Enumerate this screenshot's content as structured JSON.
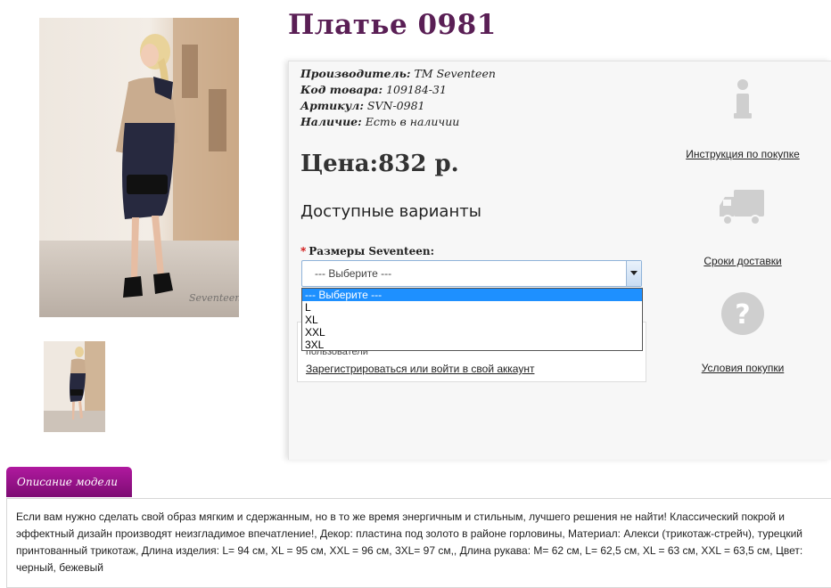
{
  "product": {
    "title": "Платье 0981",
    "meta": [
      {
        "label": "Производитель:",
        "value": "TM Seventeen"
      },
      {
        "label": "Код товара:",
        "value": "109184-31"
      },
      {
        "label": "Артикул:",
        "value": "SVN-0981"
      },
      {
        "label": "Наличие:",
        "value": "Есть в наличии"
      }
    ],
    "price": "Цена:832 р."
  },
  "options": {
    "title": "Доступные варианты",
    "size_label": "Размеры Seventeen:",
    "required_mark": "*",
    "selected": "--- Выберите ---",
    "list": [
      "--- Выберите ---",
      "L",
      "XL",
      "XXL",
      "3XL"
    ]
  },
  "review": {
    "partial_text": "пользователи",
    "login_link": "Зарегистрироваться или войти в свой аккаунт"
  },
  "sidebar": {
    "items": [
      {
        "label": "Инструкция по покупке",
        "icon": "info-icon"
      },
      {
        "label": "Сроки доставки",
        "icon": "truck-icon"
      },
      {
        "label": "Условия покупки",
        "icon": "question-icon"
      }
    ]
  },
  "description": {
    "tab_label": "Описание модели",
    "text": "Если вам нужно сделать свой образ мягким и сдержанным, но в то же время энергичным и стильным, лучшего решения не найти! Классический покрой и эффектный дизайн производят неизгладимое впечатление!, Декор: пластина под золото в районе горловины, Материал: Алекси (трикотаж-стрейч), турецкий принтованный трикотаж, Длина изделия: L= 94 см, XL = 95 см, XXL = 96 см, 3XL= 97 см,, Длина рукава: M= 62 см, L= 62,5 см, XL = 63 см, XXL = 63,5 см, Цвет: черный, бежевый"
  },
  "colors": {
    "title": "#5a1f55",
    "tab": "#9a1389",
    "icon_gray": "#cfcfcf"
  }
}
